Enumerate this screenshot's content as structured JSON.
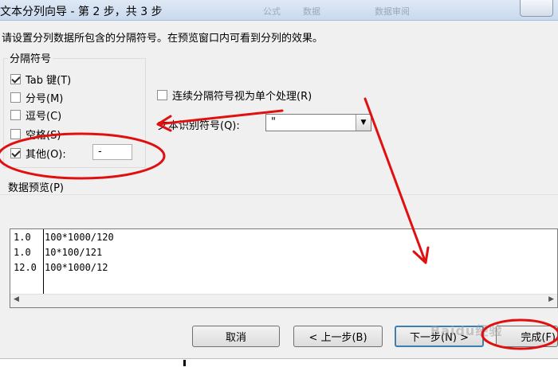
{
  "window": {
    "title": "文本分列向导 - 第 2 步，共 3 步",
    "ghost_tabs": [
      "公式",
      "数据",
      "数据审阅"
    ]
  },
  "instruction": "请设置分列数据所包含的分隔符号。在预览窗口内可看到分列的效果。",
  "delimiters": {
    "legend": "分隔符号",
    "options": [
      {
        "label": "Tab 键(T)",
        "checked": true
      },
      {
        "label": "分号(M)",
        "checked": false
      },
      {
        "label": "逗号(C)",
        "checked": false
      },
      {
        "label": "空格(S)",
        "checked": false
      },
      {
        "label": "其他(O):",
        "checked": true
      }
    ],
    "other_value": "-"
  },
  "consecutive_label": "连续分隔符号视为单个处理(R)",
  "qualifier": {
    "label": "文本识别符号(Q):",
    "value": "\""
  },
  "preview": {
    "label": "数据预览(P)",
    "rows": [
      [
        "1.0",
        "100*1000/120"
      ],
      [
        "1.0",
        "10*100/121"
      ],
      [
        "12.0",
        "100*1000/12"
      ]
    ]
  },
  "buttons": {
    "cancel": "取消",
    "back": "< 上一步(B)",
    "next": "下一步(N) >",
    "finish": "完成(F)"
  },
  "watermark": "Baidu经验",
  "colors": {
    "annotation": "#e01010"
  }
}
